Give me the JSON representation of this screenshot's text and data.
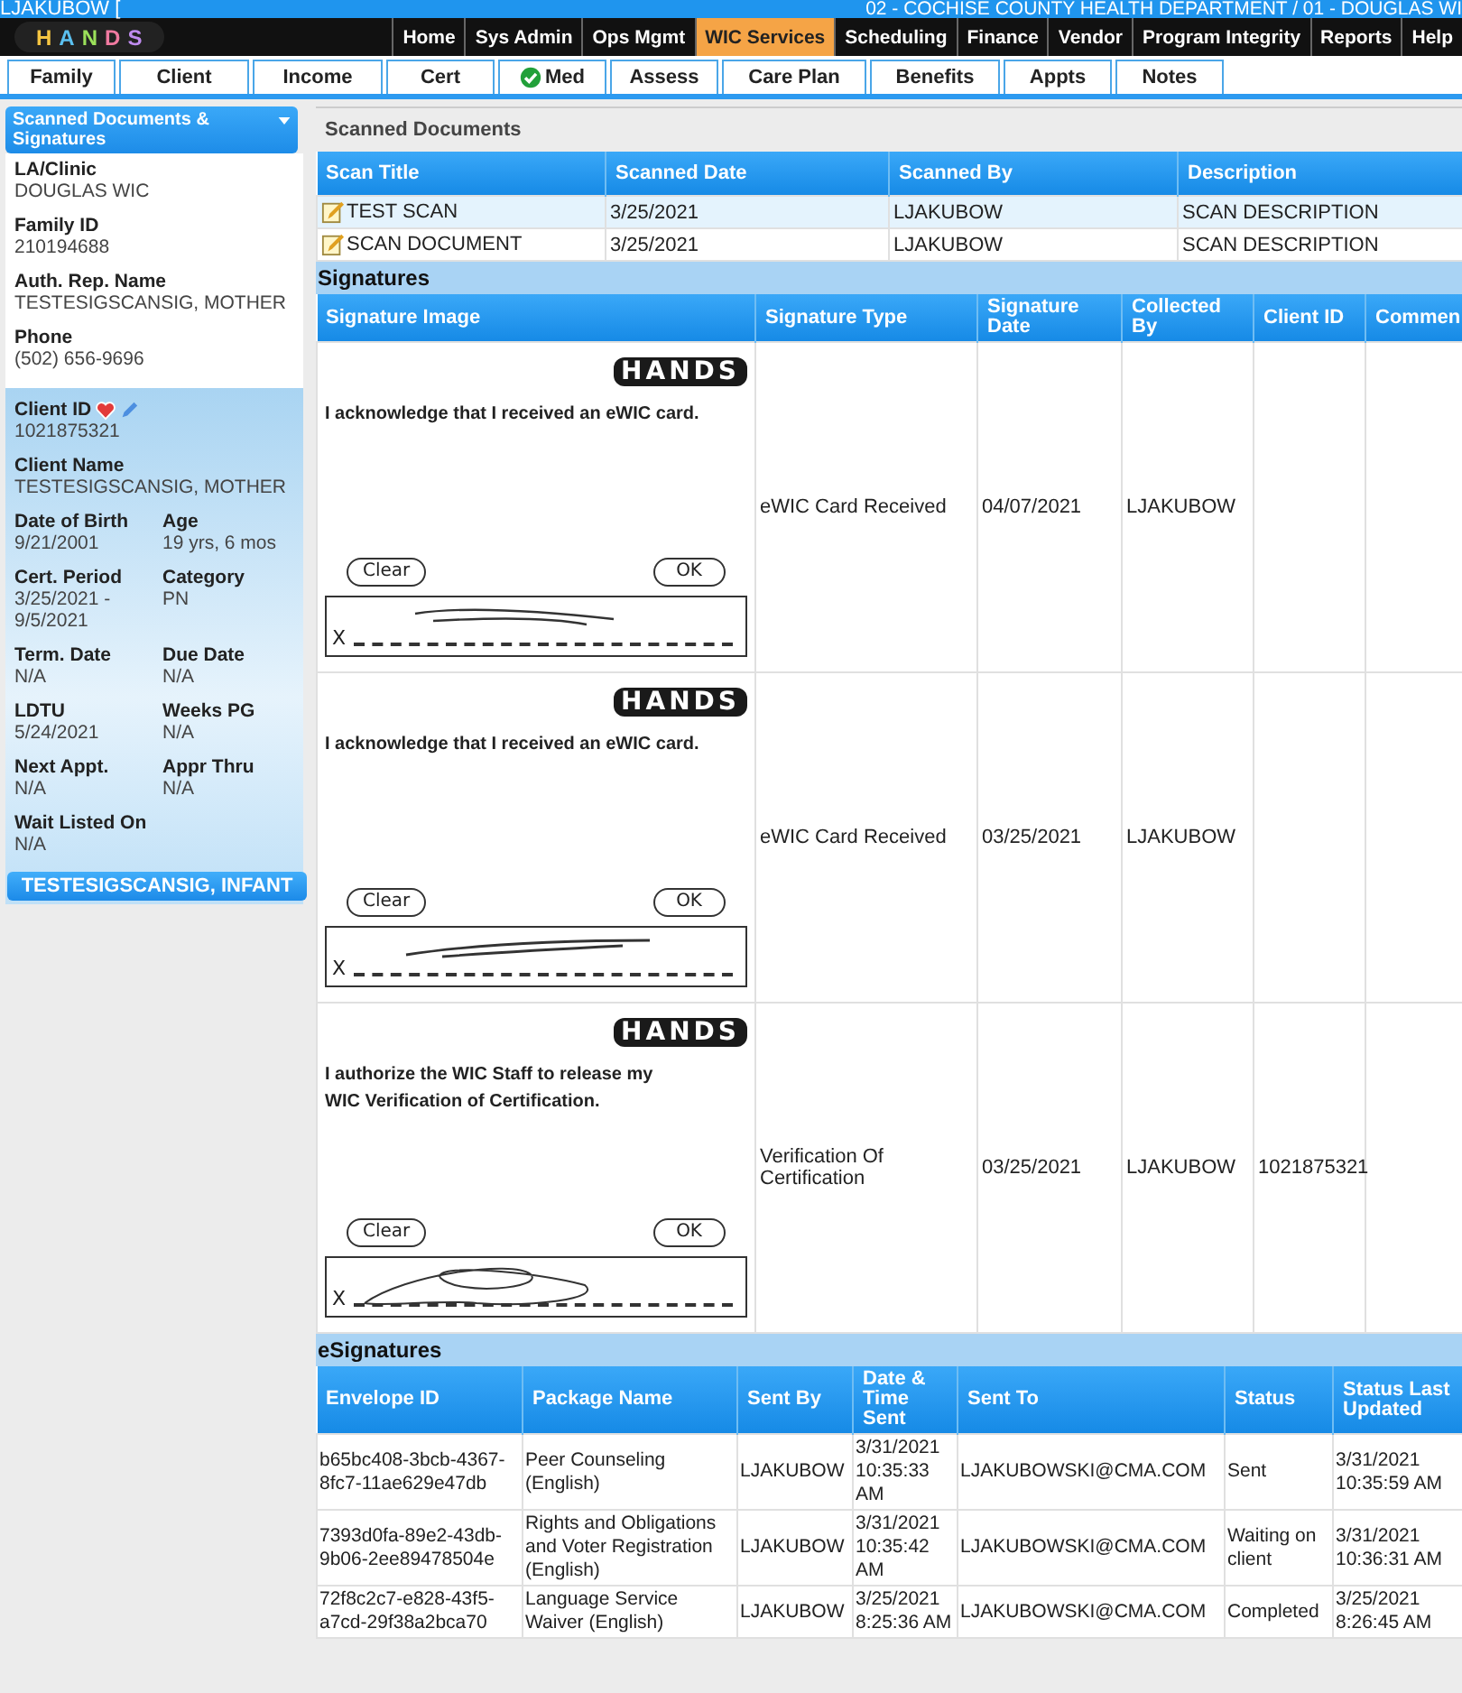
{
  "top_bar": {
    "user": "LJAKUBOW [",
    "agency": "02 - COCHISE COUNTY HEALTH DEPARTMENT / 01 - DOUGLAS WI"
  },
  "logo": {
    "letters": [
      "H",
      "A",
      "N",
      "D",
      "S"
    ]
  },
  "nav": [
    {
      "label": "Home",
      "selected": false
    },
    {
      "label": "Sys Admin",
      "selected": false
    },
    {
      "label": "Ops Mgmt",
      "selected": false
    },
    {
      "label": "WIC Services",
      "selected": true
    },
    {
      "label": "Scheduling",
      "selected": false
    },
    {
      "label": "Finance",
      "selected": false
    },
    {
      "label": "Vendor",
      "selected": false
    },
    {
      "label": "Program Integrity",
      "selected": false
    },
    {
      "label": "Reports",
      "selected": false
    },
    {
      "label": "Help",
      "selected": false
    }
  ],
  "tabs": [
    {
      "label": "Family",
      "checked": false
    },
    {
      "label": "Client",
      "checked": false
    },
    {
      "label": "Income",
      "checked": false
    },
    {
      "label": "Cert",
      "checked": false
    },
    {
      "label": "Med",
      "checked": true
    },
    {
      "label": "Assess",
      "checked": false
    },
    {
      "label": "Care Plan",
      "checked": false
    },
    {
      "label": "Benefits",
      "checked": false
    },
    {
      "label": "Appts",
      "checked": false
    },
    {
      "label": "Notes",
      "checked": false
    }
  ],
  "sidebar": {
    "menu": "Scanned Documents & Signatures",
    "family_fields": [
      {
        "label": "LA/Clinic",
        "value": "DOUGLAS WIC"
      },
      {
        "label": "Family ID",
        "value": "210194688"
      },
      {
        "label": "Auth. Rep. Name",
        "value": "TESTESIGSCANSIG, MOTHER"
      },
      {
        "label": "Phone",
        "value": "(502) 656-9696"
      }
    ],
    "client_fields": [
      {
        "kind": "id",
        "label": "Client ID",
        "value": "1021875321"
      },
      {
        "kind": "wide",
        "label": "Client Name",
        "value": "TESTESIGSCANSIG, MOTHER"
      },
      {
        "kind": "half",
        "label": "Date of Birth",
        "value": "9/21/2001"
      },
      {
        "kind": "half",
        "label": "Age",
        "value": "19 yrs, 6 mos"
      },
      {
        "kind": "half",
        "label": "Cert. Period",
        "value": "3/25/2021 - 9/5/2021"
      },
      {
        "kind": "half",
        "label": "Category",
        "value": "PN"
      },
      {
        "kind": "half",
        "label": "Term. Date",
        "value": "N/A"
      },
      {
        "kind": "half",
        "label": "Due Date",
        "value": "N/A"
      },
      {
        "kind": "half",
        "label": "LDTU",
        "value": "5/24/2021"
      },
      {
        "kind": "half",
        "label": "Weeks PG",
        "value": "N/A"
      },
      {
        "kind": "half",
        "label": "Next Appt.",
        "value": "N/A"
      },
      {
        "kind": "half",
        "label": "Appr Thru",
        "value": "N/A"
      },
      {
        "kind": "wide",
        "label": "Wait Listed On",
        "value": "N/A"
      }
    ],
    "other_client": "TESTESIGSCANSIG, INFANT"
  },
  "scanned": {
    "title": "Scanned Documents",
    "columns": [
      "Scan Title",
      "Scanned Date",
      "Scanned By",
      "Description"
    ],
    "rows": [
      {
        "title": "TEST SCAN",
        "date": "3/25/2021",
        "by": "LJAKUBOW",
        "description": "SCAN DESCRIPTION",
        "selected": true
      },
      {
        "title": "SCAN DOCUMENT",
        "date": "3/25/2021",
        "by": "LJAKUBOW",
        "description": "SCAN DESCRIPTION",
        "selected": false
      }
    ]
  },
  "signatures": {
    "title": "Signatures",
    "columns": [
      "Signature Image",
      "Signature Type",
      "Signature Date",
      "Collected By",
      "Client ID",
      "Commen"
    ],
    "rows": [
      {
        "logo": "HANDS",
        "statement": "I acknowledge that I received an eWIC card.",
        "clear": "Clear",
        "ok": "OK",
        "x": "X",
        "type": "eWIC Card Received",
        "date": "04/07/2021",
        "collected_by": "LJAKUBOW",
        "client_id": ""
      },
      {
        "logo": "HANDS",
        "statement": "I acknowledge that I received an eWIC card.",
        "clear": "Clear",
        "ok": "OK",
        "x": "X",
        "type": "eWIC Card Received",
        "date": "03/25/2021",
        "collected_by": "LJAKUBOW",
        "client_id": ""
      },
      {
        "logo": "HANDS",
        "statement": "I authorize the WIC Staff to release my WIC Verification of Certification.",
        "clear": "Clear",
        "ok": "OK",
        "x": "X",
        "type": "Verification Of Certification",
        "date": "03/25/2021",
        "collected_by": "LJAKUBOW",
        "client_id": "1021875321"
      }
    ]
  },
  "esignatures": {
    "title": "eSignatures",
    "columns": [
      "Envelope ID",
      "Package Name",
      "Sent By",
      "Date & Time Sent",
      "Sent To",
      "Status",
      "Status Last Updated"
    ],
    "rows": [
      [
        "b65bc408-3bcb-4367-8fc7-11ae629e47db",
        "Peer Counseling (English)",
        "LJAKUBOW",
        "3/31/2021 10:35:33 AM",
        "LJAKUBOWSKI@CMA.COM",
        "Sent",
        "3/31/2021 10:35:59 AM"
      ],
      [
        "7393d0fa-89e2-43db-9b06-2ee89478504e",
        "Rights and Obligations and Voter Registration (English)",
        "LJAKUBOW",
        "3/31/2021 10:35:42 AM",
        "LJAKUBOWSKI@CMA.COM",
        "Waiting on client",
        "3/31/2021 10:36:31 AM"
      ],
      [
        "72f8c2c7-e828-43f5-a7cd-29f38a2bca70",
        "Language Service Waiver (English)",
        "LJAKUBOW",
        "3/25/2021 8:25:36 AM",
        "LJAKUBOWSKI@CMA.COM",
        "Completed",
        "3/25/2021 8:26:45 AM"
      ]
    ]
  }
}
